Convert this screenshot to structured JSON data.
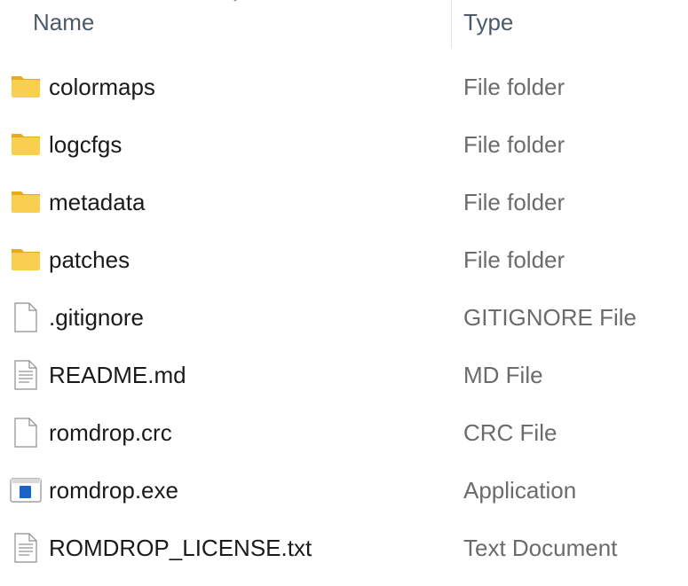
{
  "header": {
    "name_label": "Name",
    "type_label": "Type"
  },
  "files": [
    {
      "name": "colormaps",
      "type": "File folder",
      "icon": "folder-icon"
    },
    {
      "name": "logcfgs",
      "type": "File folder",
      "icon": "folder-icon"
    },
    {
      "name": "metadata",
      "type": "File folder",
      "icon": "folder-icon"
    },
    {
      "name": "patches",
      "type": "File folder",
      "icon": "folder-icon"
    },
    {
      "name": ".gitignore",
      "type": "GITIGNORE File",
      "icon": "blank-file-icon"
    },
    {
      "name": "README.md",
      "type": "MD File",
      "icon": "text-file-icon"
    },
    {
      "name": "romdrop.crc",
      "type": "CRC File",
      "icon": "blank-file-icon"
    },
    {
      "name": "romdrop.exe",
      "type": "Application",
      "icon": "application-icon"
    },
    {
      "name": "ROMDROP_LICENSE.txt",
      "type": "Text Document",
      "icon": "text-file-icon"
    }
  ],
  "colors": {
    "folder_body": "#f8cf4f",
    "folder_tab": "#e8a91c",
    "app_blue": "#1c63c7"
  }
}
